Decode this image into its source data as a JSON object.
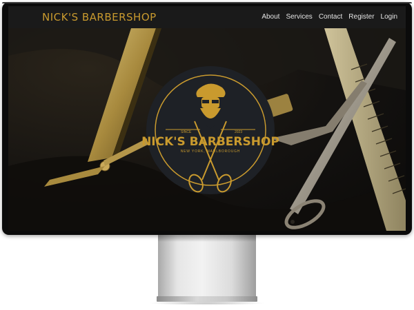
{
  "site": {
    "brand": "NICK'S BARBERSHOP"
  },
  "nav": {
    "items": [
      {
        "label": "About"
      },
      {
        "label": "Services"
      },
      {
        "label": "Contact"
      },
      {
        "label": "Register"
      },
      {
        "label": "Login"
      }
    ]
  },
  "logo": {
    "title": "NICK'S BARBERSHOP",
    "since": "SINCE",
    "year": "2023",
    "location": "NEW YORK, MARLBOROUGH"
  },
  "colors": {
    "accent": "#c99a2e",
    "nav_bg": "#1a1a1a",
    "nav_text": "#e6e6e6",
    "logo_bg": "#1e2126"
  },
  "icons": {
    "hero": "razor-scissors-comb-photo",
    "logo": "bearded-barber-with-scissors"
  }
}
